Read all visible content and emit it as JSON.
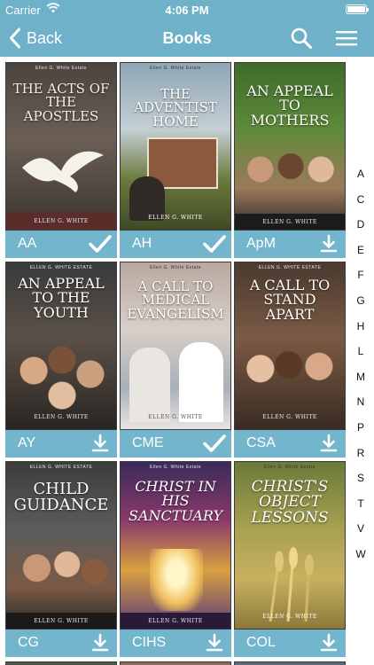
{
  "status_bar": {
    "carrier": "Carrier",
    "time": "4:06 PM"
  },
  "nav": {
    "back_label": "Back",
    "title": "Books"
  },
  "books": [
    {
      "code": "AA",
      "state": "downloaded",
      "cover_title": "THE ACTS OF THE APOSTLES",
      "cover_top": "Ellen G. White Estate",
      "cover_author": "ELLEN G. WHITE"
    },
    {
      "code": "AH",
      "state": "downloaded",
      "cover_title": "THE ADVENTIST HOME",
      "cover_top": "Ellen G. White Estate",
      "cover_author": "ELLEN G. WHITE"
    },
    {
      "code": "ApM",
      "state": "download",
      "cover_title": "AN APPEAL TO MOTHERS",
      "cover_top": "",
      "cover_author": "ELLEN G. WHITE"
    },
    {
      "code": "AY",
      "state": "download",
      "cover_title": "AN APPEAL TO THE YOUTH",
      "cover_top": "ELLEN G. WHITE ESTATE",
      "cover_author": "ELLEN G. WHITE"
    },
    {
      "code": "CME",
      "state": "downloaded",
      "cover_title": "A CALL TO MEDICAL EVANGELISM",
      "cover_top": "Ellen G. White Estate",
      "cover_author": "ELLEN G. WHITE"
    },
    {
      "code": "CSA",
      "state": "download",
      "cover_title": "A CALL TO STAND APART",
      "cover_top": "ELLEN G. WHITE ESTATE",
      "cover_author": "ELLEN G. WHITE"
    },
    {
      "code": "CG",
      "state": "download",
      "cover_title": "CHILD GUIDANCE",
      "cover_top": "ELLEN G. WHITE ESTATE",
      "cover_author": "ELLEN G. WHITE"
    },
    {
      "code": "CIHS",
      "state": "download",
      "cover_title": "CHRIST IN HIS SANCTUARY",
      "cover_top": "Ellen G. White Estate",
      "cover_author": "ELLEN G. WHITE"
    },
    {
      "code": "COL",
      "state": "download",
      "cover_title": "CHRIST'S OBJECT LESSONS",
      "cover_top": "Ellen G. White Estate",
      "cover_author": "ELLEN G. WHITE"
    }
  ],
  "alpha_index": [
    "A",
    "C",
    "D",
    "E",
    "F",
    "G",
    "H",
    "L",
    "M",
    "N",
    "P",
    "R",
    "S",
    "T",
    "V",
    "W"
  ],
  "colors": {
    "bar": "#6eb1c9",
    "caption": "#73b5cd",
    "text": "#ffffff"
  },
  "icons": {
    "back": "chevron-left-icon",
    "search": "search-icon",
    "menu": "hamburger-menu-icon",
    "downloaded": "checkmark-icon",
    "download": "download-icon"
  }
}
